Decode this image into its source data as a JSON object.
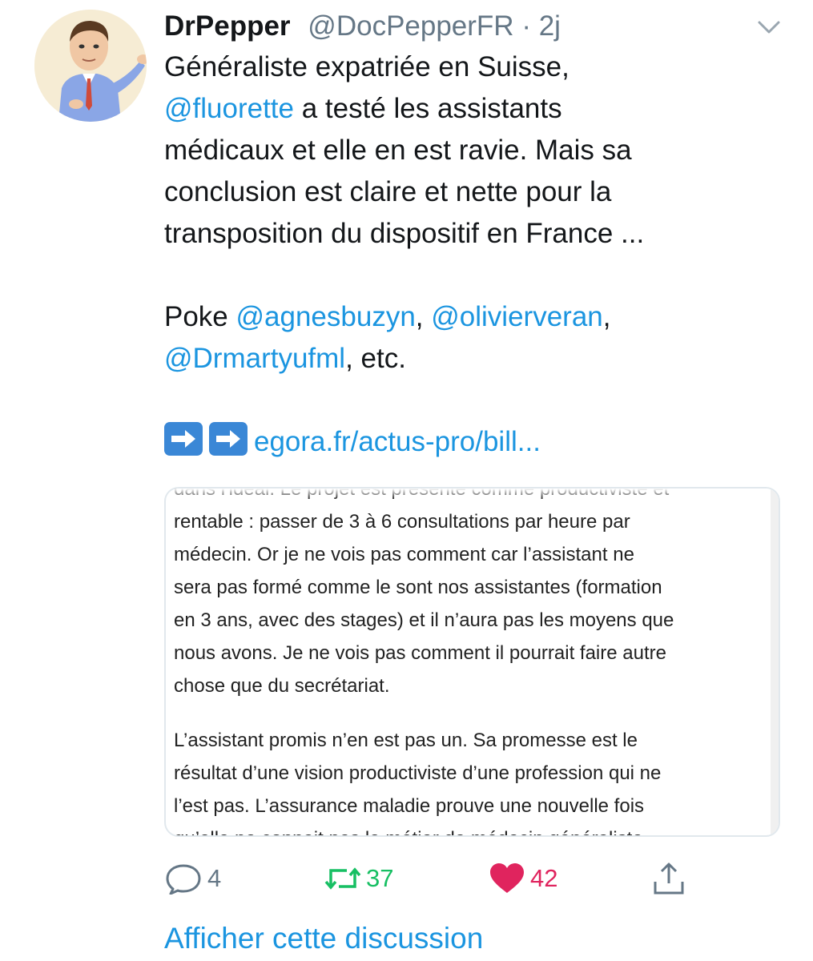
{
  "tweet": {
    "author_name": "DrPepper",
    "author_handle": "@DocPepperFR",
    "separator": "·",
    "timestamp": "2j",
    "text": {
      "line1": "Généraliste expatriée en Suisse,",
      "mention_fluorette": "@fluorette",
      "line2_rest": " a testé les assistants",
      "line3": "médicaux et elle en est ravie. Mais sa",
      "line4": "conclusion est claire et nette pour la",
      "line5": "transposition du dispositif en France ...",
      "poke_prefix": "Poke ",
      "mention_agnes": "@agnesbuzyn",
      "comma1": ", ",
      "mention_olivier": "@olivierveran",
      "comma2": ",",
      "mention_drmarty": "@Drmartyufml",
      "etc": ", etc.",
      "link": "egora.fr/actus-pro/bill..."
    },
    "card": {
      "partial_top": "dans l'idéal. Le projet est présenté comme productiviste et",
      "lines_p1": [
        "rentable : passer de 3 à 6 consultations par heure par",
        "médecin. Or je ne vois pas comment car l’assistant ne",
        "sera pas formé comme le sont nos assistantes (formation",
        "en 3 ans, avec des stages) et il n’aura pas les moyens que",
        "nous avons. Je ne vois pas comment il pourrait faire autre",
        "chose que du secrétariat."
      ],
      "lines_p2": [
        "L’assistant promis n’en est pas un. Sa promesse est le",
        "résultat d’une vision productiviste d’une profession qui ne",
        "l’est pas. L’assurance maladie prouve une nouvelle fois",
        "qu’elle ne connait pas le métier de médecin généraliste."
      ]
    },
    "actions": {
      "reply_count": "4",
      "retweet_count": "37",
      "like_count": "42"
    },
    "thread_link": "Afficher cette discussion"
  },
  "colors": {
    "link": "#1b95e0",
    "retweet": "#17bf63",
    "like": "#e0245e",
    "muted": "#657786"
  },
  "icons": [
    "chevron-down-icon",
    "arrow-right-emoji",
    "reply-icon",
    "retweet-icon",
    "heart-icon",
    "share-icon"
  ]
}
